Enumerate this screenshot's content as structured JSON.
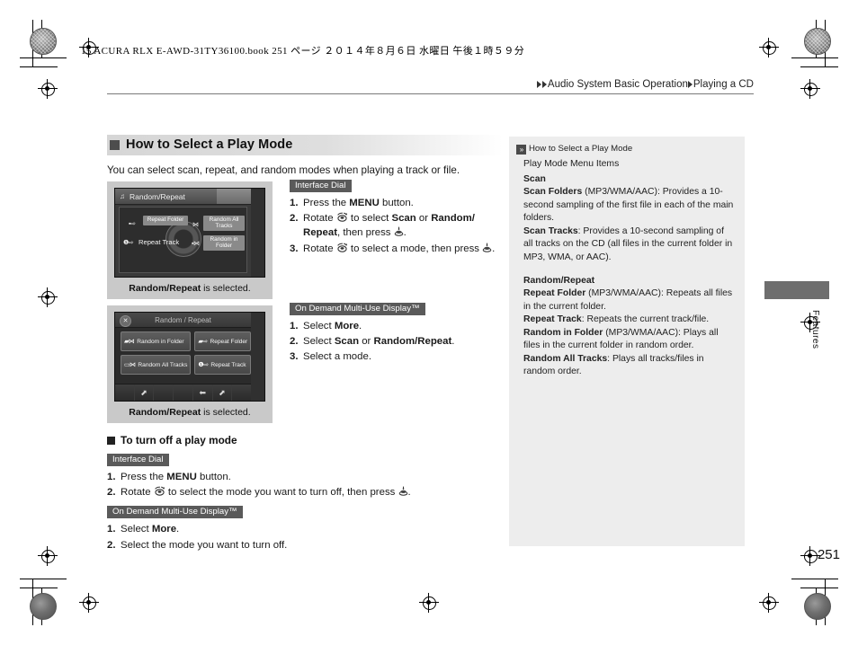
{
  "print_slug": "15 ACURA RLX E-AWD-31TY36100.book   251 ページ   ２０１４年８月６日   水曜日   午後１時５９分",
  "header": {
    "breadcrumb_1": "Audio System Basic Operation",
    "breadcrumb_2": "Playing a CD"
  },
  "main": {
    "section_title": "How to Select a Play Mode",
    "lead": "You can select scan, repeat, and random modes when playing a track or file.",
    "figure_ifd": {
      "screen_title": "Random/Repeat",
      "note_icon": "music-note-icon",
      "buttons": {
        "repeat_folder": "Repeat Folder",
        "random_all_tracks": "Random All Tracks",
        "repeat_track": "Repeat Track",
        "random_in_folder": "Random in Folder"
      },
      "glyphs": {
        "repeat_folder_icon": "folder-repeat-icon",
        "random_folder_icon": "folder-random-icon",
        "repeat_track_icon": "track-repeat-icon",
        "random_track_icon": "track-random-icon"
      },
      "caption_bold": "Random/Repeat",
      "caption_rest": " is selected."
    },
    "figure_odmd": {
      "screen_title": "Random / Repeat",
      "close_icon": "close-icon",
      "buttons": [
        {
          "label": "Random in Folder",
          "icon": "folder-random-icon"
        },
        {
          "label": "Repeat  Folder",
          "icon": "folder-repeat-icon"
        },
        {
          "label": "Random All Tracks",
          "icon": "track-random-icon"
        },
        {
          "label": "Repeat  Track",
          "icon": "track-repeat-icon"
        }
      ],
      "footer_icons": [
        "menu-arrow-icon",
        "back-arrow-icon",
        "menu-arrow-icon"
      ],
      "caption_bold": "Random/Repeat",
      "caption_rest": " is selected."
    },
    "instructions_ifd": {
      "tag": "Interface Dial",
      "steps": [
        {
          "num": "1.",
          "html": "Press the <b>MENU</b> button."
        },
        {
          "num": "2.",
          "html": "Rotate <span class=\"ic-rotate\"></span> to select <b>Scan</b> or <b>Random/ Repeat</b>, then press <span class=\"ic-press\"></span>."
        },
        {
          "num": "3.",
          "html": "Rotate <span class=\"ic-rotate\"></span> to select a mode, then press <span class=\"ic-press\"></span>."
        }
      ]
    },
    "instructions_odmd": {
      "tag": "On Demand Multi-Use Display™",
      "steps": [
        {
          "num": "1.",
          "html": "Select <b>More</b>."
        },
        {
          "num": "2.",
          "html": "Select <b>Scan</b> or <b>Random/Repeat</b>."
        },
        {
          "num": "3.",
          "html": "Select a mode."
        }
      ]
    },
    "turn_off": {
      "title": "To turn off a play mode",
      "tag_ifd": "Interface Dial",
      "steps_ifd": [
        {
          "num": "1.",
          "html": "Press the <b>MENU</b> button."
        },
        {
          "num": "2.",
          "html": "Rotate <span class=\"ic-rotate\"></span> to select the mode you want to turn off, then press <span class=\"ic-press\"></span>."
        }
      ],
      "tag_odmd": "On Demand Multi-Use Display™",
      "steps_odmd": [
        {
          "num": "1.",
          "html": "Select <b>More</b>."
        },
        {
          "num": "2.",
          "html": "Select the mode you want to turn off."
        }
      ]
    }
  },
  "sidebar": {
    "chevron_icon": "double-chevron-right-icon",
    "title": "How to Select a Play Mode",
    "subtitle": "Play Mode Menu Items",
    "group_scan_heading": "Scan",
    "scan_folders_term": "Scan Folders",
    "scan_folders_desc": " (MP3/WMA/AAC): Provides a 10-second sampling of the first file in each of the main folders.",
    "scan_tracks_term": "Scan Tracks",
    "scan_tracks_desc": ": Provides a 10-second sampling of all tracks on the CD (all files in the current folder in MP3, WMA, or AAC).",
    "group_rr_heading": "Random/Repeat",
    "repeat_folder_term": "Repeat Folder",
    "repeat_folder_desc": " (MP3/WMA/AAC): Repeats all files in the current folder.",
    "repeat_track_term": "Repeat Track",
    "repeat_track_desc": ": Repeats the current track/file.",
    "random_in_folder_term": "Random in Folder",
    "random_in_folder_desc": " (MP3/WMA/AAC): Plays all files in the current folder in random order.",
    "random_all_tracks_term": "Random All Tracks",
    "random_all_tracks_desc": ": Plays all tracks/files in random order."
  },
  "edge": {
    "tab_label": "Features",
    "page_number": "251"
  },
  "colors": {
    "sidebar_bg": "#ededed",
    "tag_bg": "#5a5a5a",
    "heading_bar": "#d6d6d6",
    "edge_tab": "#6e6e6e",
    "figure_panel": "#c9c9c9"
  }
}
